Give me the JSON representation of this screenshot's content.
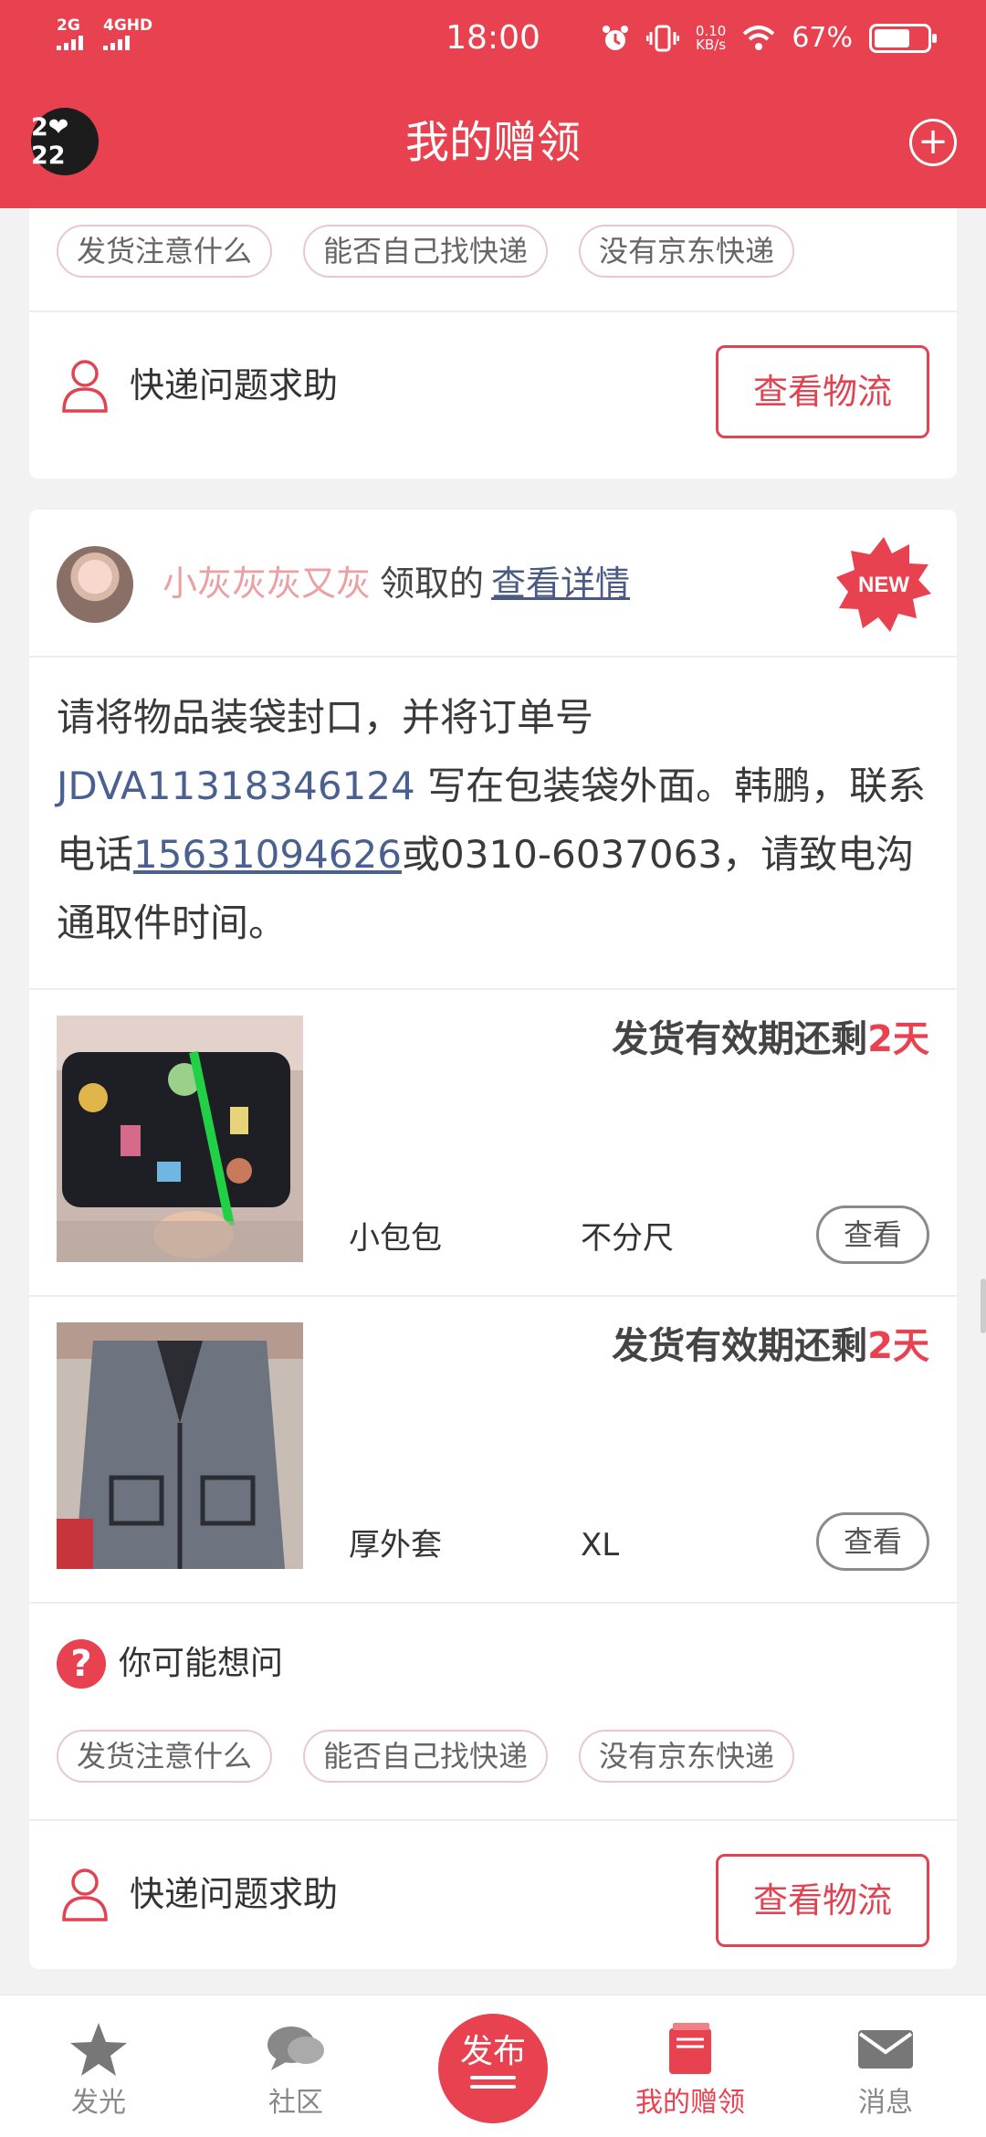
{
  "status_bar": {
    "signal_1": "2G",
    "signal_2": "4GHD",
    "time": "18:00",
    "speed_value": "0.10",
    "speed_unit": "KB/s",
    "battery": "67%",
    "battery_level": 0.67
  },
  "header": {
    "avatar_text": "2❤22",
    "title": "我的赠领",
    "add_icon": "plus-circle-icon"
  },
  "top_card": {
    "tags": [
      "发货注意什么",
      "能否自己找快递",
      "没有京东快递"
    ],
    "help_text": "快递问题求助",
    "logistics_button": "查看物流"
  },
  "order_card": {
    "user_name": "小灰灰灰又灰",
    "claimed_text": "领取的",
    "detail_link": "查看详情",
    "new_badge": "NEW",
    "message_pre": "请将物品装袋封口，并将订单号 ",
    "order_number": "JDVA11318346124",
    "message_mid": " 写在包装袋外面。韩鹏，联系电话",
    "phone_1": "15631094626",
    "message_post": "或0310-6037063，请致电沟通取件时间。",
    "items": [
      {
        "expire_prefix": "发货有效期还剩",
        "expire_days": "2天",
        "name": "小包包",
        "size": "不分尺",
        "view_label": "查看"
      },
      {
        "expire_prefix": "发货有效期还剩",
        "expire_days": "2天",
        "name": "厚外套",
        "size": "XL",
        "view_label": "查看"
      }
    ],
    "faq_title": "你可能想问",
    "faq_tags": [
      "发货注意什么",
      "能否自己找快递",
      "没有京东快递"
    ],
    "help_text": "快递问题求助",
    "logistics_button": "查看物流"
  },
  "bottom_nav": {
    "items": [
      {
        "label": "发光",
        "icon": "star-icon"
      },
      {
        "label": "社区",
        "icon": "chat-bubbles-icon"
      },
      {
        "label": "发布",
        "icon": "publish-icon"
      },
      {
        "label": "我的赠领",
        "icon": "gift-book-icon"
      },
      {
        "label": "消息",
        "icon": "envelope-icon"
      }
    ],
    "active_index": 3
  },
  "colors": {
    "brand": "#e8414f",
    "link": "#4a6090",
    "username": "#eba0a3"
  }
}
